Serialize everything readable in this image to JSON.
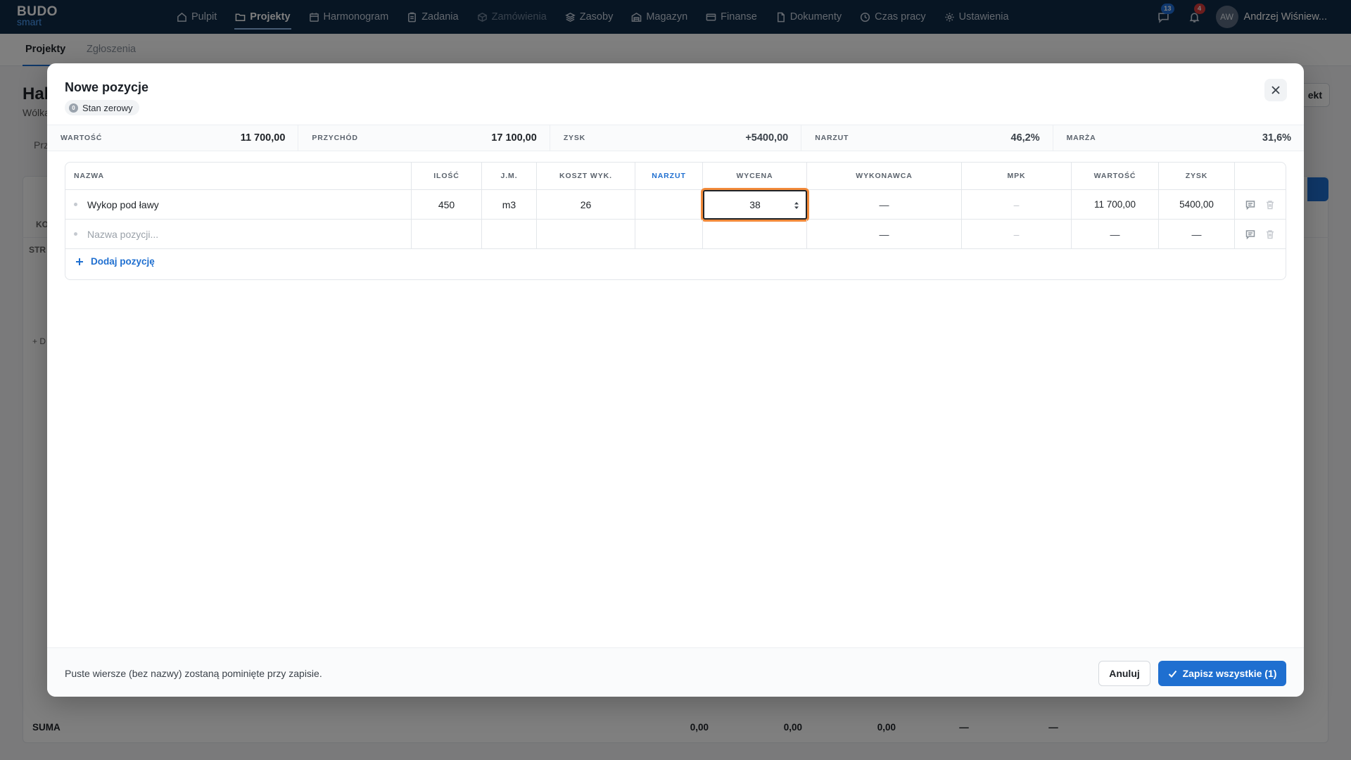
{
  "app": {
    "logo_top": "BUDO",
    "logo_bottom": "smart"
  },
  "nav": {
    "items": [
      {
        "label": "Pulpit",
        "icon": "home-icon",
        "state": "normal"
      },
      {
        "label": "Projekty",
        "icon": "folder-icon",
        "state": "active"
      },
      {
        "label": "Harmonogram",
        "icon": "calendar-icon",
        "state": "normal"
      },
      {
        "label": "Zadania",
        "icon": "clipboard-icon",
        "state": "normal"
      },
      {
        "label": "Zamówienia",
        "icon": "box-icon",
        "state": "disabled"
      },
      {
        "label": "Zasoby",
        "icon": "layers-icon",
        "state": "normal"
      },
      {
        "label": "Magazyn",
        "icon": "warehouse-icon",
        "state": "normal"
      },
      {
        "label": "Finanse",
        "icon": "wallet-icon",
        "state": "normal"
      },
      {
        "label": "Dokumenty",
        "icon": "document-icon",
        "state": "normal"
      },
      {
        "label": "Czas pracy",
        "icon": "clock-icon",
        "state": "normal"
      },
      {
        "label": "Ustawienia",
        "icon": "gear-icon",
        "state": "normal"
      }
    ],
    "messages_badge": "13",
    "notifications_badge": "4",
    "user_initials": "AW",
    "user_name": "Andrzej Wiśniew..."
  },
  "background": {
    "subtabs": [
      "Projekty",
      "Zgłoszenia"
    ],
    "title": "Hal",
    "subtitle": "Wólka",
    "action_partial": "ekt",
    "tab_partial": "Prz",
    "row_label_ko": "KO",
    "row_label_str": "STR",
    "add_partial": "+ D",
    "suma": {
      "label": "SUMA",
      "values": [
        "0,00",
        "0,00",
        "0,00",
        "—",
        "—"
      ]
    }
  },
  "modal": {
    "title": "Nowe pozycje",
    "tag_label": "Stan zerowy",
    "tag_dot": "0",
    "summary": [
      {
        "key": "WARTOŚĆ",
        "value": "11 700,00"
      },
      {
        "key": "PRZYCHÓD",
        "value": "17 100,00"
      },
      {
        "key": "ZYSK",
        "value": "+5400,00"
      },
      {
        "key": "NARZUT",
        "value": "46,2%"
      },
      {
        "key": "MARŻA",
        "value": "31,6%"
      }
    ],
    "columns": [
      "NAZWA",
      "ILOŚĆ",
      "J.M.",
      "KOSZT WYK.",
      "NARZUT",
      "WYCENA",
      "WYKONAWCA",
      "MPK",
      "WARTOŚĆ",
      "ZYSK",
      ""
    ],
    "rows": [
      {
        "name": "Wykop pod ławy",
        "qty": "450",
        "unit": "m3",
        "cost": "26",
        "markup": "",
        "price": "38",
        "contractor": "—",
        "mpk": "–",
        "value": "11 700,00",
        "profit": "5400,00"
      },
      {
        "name_placeholder": "Nazwa pozycji...",
        "qty": "",
        "unit": "",
        "cost": "",
        "markup": "",
        "price": "",
        "contractor": "—",
        "mpk": "–",
        "value": "—",
        "profit": "—"
      }
    ],
    "add_label": "Dodaj pozycję",
    "footer_note": "Puste wiersze (bez nazwy) zostaną pominięte przy zapisie.",
    "cancel_label": "Anuluj",
    "save_label": "Zapisz wszystkie (1)"
  },
  "colors": {
    "nav_bg": "#0f2a47",
    "accent": "#1f6fd0",
    "focus_ring": "#f28a3a"
  }
}
